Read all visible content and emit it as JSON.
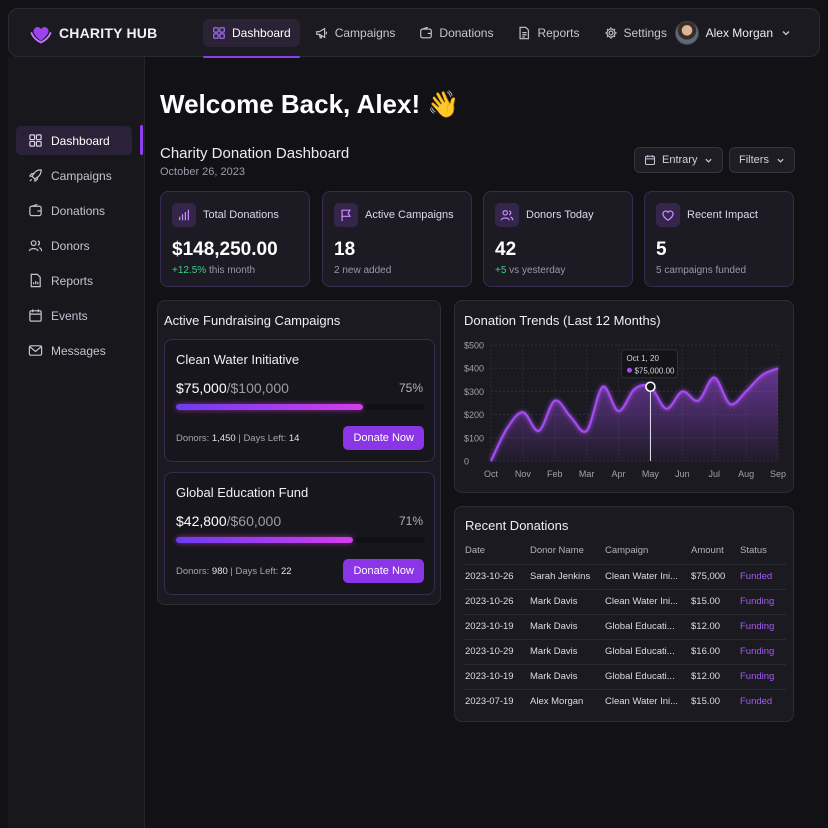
{
  "brand": {
    "name": "CHARITY HUB"
  },
  "topnav": [
    {
      "label": "Dashboard",
      "icon": "grid-icon",
      "active": true
    },
    {
      "label": "Campaigns",
      "icon": "megaphone-icon"
    },
    {
      "label": "Donations",
      "icon": "wallet-icon"
    },
    {
      "label": "Reports",
      "icon": "document-icon"
    },
    {
      "label": "Settings",
      "icon": "gear-icon"
    }
  ],
  "user": {
    "name": "Alex Morgan"
  },
  "sidebar": [
    {
      "label": "Dashboard",
      "icon": "grid-icon",
      "active": true
    },
    {
      "label": "Campaigns",
      "icon": "rocket-icon"
    },
    {
      "label": "Donations",
      "icon": "wallet-icon"
    },
    {
      "label": "Donors",
      "icon": "users-icon"
    },
    {
      "label": "Reports",
      "icon": "report-icon"
    },
    {
      "label": "Events",
      "icon": "calendar-icon"
    },
    {
      "label": "Messages",
      "icon": "mail-icon"
    }
  ],
  "main": {
    "welcome": "Welcome Back, Alex! 👋",
    "title": "Charity Donation Dashboard",
    "date": "October 26, 2023",
    "filter1": "Entrary",
    "filter2": "Filters"
  },
  "stats": [
    {
      "label": "Total Donations",
      "value": "$148,250.00",
      "sub_highlight": "+12.5%",
      "sub": " this month",
      "icon": "bar-chart-icon"
    },
    {
      "label": "Active Campaigns",
      "value": "18",
      "sub_highlight": "",
      "sub": "2 new added",
      "icon": "flag-icon"
    },
    {
      "label": "Donors Today",
      "value": "42",
      "sub_highlight": "+5",
      "sub": " vs yesterday",
      "icon": "users-icon"
    },
    {
      "label": "Recent Impact",
      "value": "5",
      "sub_highlight": "",
      "sub": "5 campaigns funded",
      "icon": "heart-icon"
    }
  ],
  "campaigns": {
    "title": "Active Fundraising Campaigns",
    "items": [
      {
        "name": "Clean Water Initiative",
        "raised": "$75,000",
        "goal": "/$100,000",
        "percent": "75%",
        "progress": 0.75,
        "donors_label": "Donors: ",
        "donors": "1,450",
        "sep": " | ",
        "days_label": "Days Left: ",
        "days": "14",
        "button": "Donate Now"
      },
      {
        "name": "Global Education Fund",
        "raised": "$42,800",
        "goal": "/$60,000",
        "percent": "71%",
        "progress": 0.71,
        "donors_label": "Donors: ",
        "donors": "980",
        "sep": " | ",
        "days_label": "Days Left: ",
        "days": "22",
        "button": "Donate Now"
      }
    ]
  },
  "chart_data": {
    "type": "area",
    "title": "Donation Trends (Last 12 Months)",
    "categories": [
      "Oct",
      "Nov",
      "Feb",
      "Mar",
      "Apr",
      "May",
      "Jun",
      "Jul",
      "Aug",
      "Sep"
    ],
    "x": [
      0,
      0.5,
      1,
      1.5,
      2,
      2.5,
      3,
      3.5,
      4,
      4.5,
      5,
      5.5,
      6,
      6.5,
      7,
      7.5,
      8,
      8.5,
      9
    ],
    "values": [
      0,
      140,
      210,
      130,
      260,
      190,
      130,
      320,
      215,
      310,
      320,
      225,
      300,
      260,
      360,
      245,
      300,
      370,
      400
    ],
    "ylim": [
      0,
      500
    ],
    "yticks": [
      "$500",
      "$400",
      "$300",
      "$200",
      "$100",
      "0"
    ],
    "grid": true,
    "tooltip": {
      "date": "Oct 1, 20",
      "value": "$75,000.00"
    },
    "highlight_x": 5,
    "color": "#a44bf0"
  },
  "recent": {
    "title": "Recent Donations",
    "columns": [
      "Date",
      "Donor Name",
      "Campaign",
      "Amount",
      "Status"
    ],
    "rows": [
      [
        "2023-10-26",
        "Sarah Jenkins",
        "Clean Water Ini...",
        "$75,000",
        "Funded"
      ],
      [
        "2023-10-26",
        "Mark Davis",
        "Clean Water Ini...",
        "$15.00",
        "Funding"
      ],
      [
        "2023-10-19",
        "Mark Davis",
        "Global Educati...",
        "$12.00",
        "Funding"
      ],
      [
        "2023-10-29",
        "Mark Davis",
        "Global Educati...",
        "$16.00",
        "Funding"
      ],
      [
        "2023-10-19",
        "Mark Davis",
        "Global Educati...",
        "$12.00",
        "Funding"
      ],
      [
        "2023-07-19",
        "Alex Morgan",
        "Clean Water Ini...",
        "$15.00",
        "Funded"
      ]
    ]
  }
}
